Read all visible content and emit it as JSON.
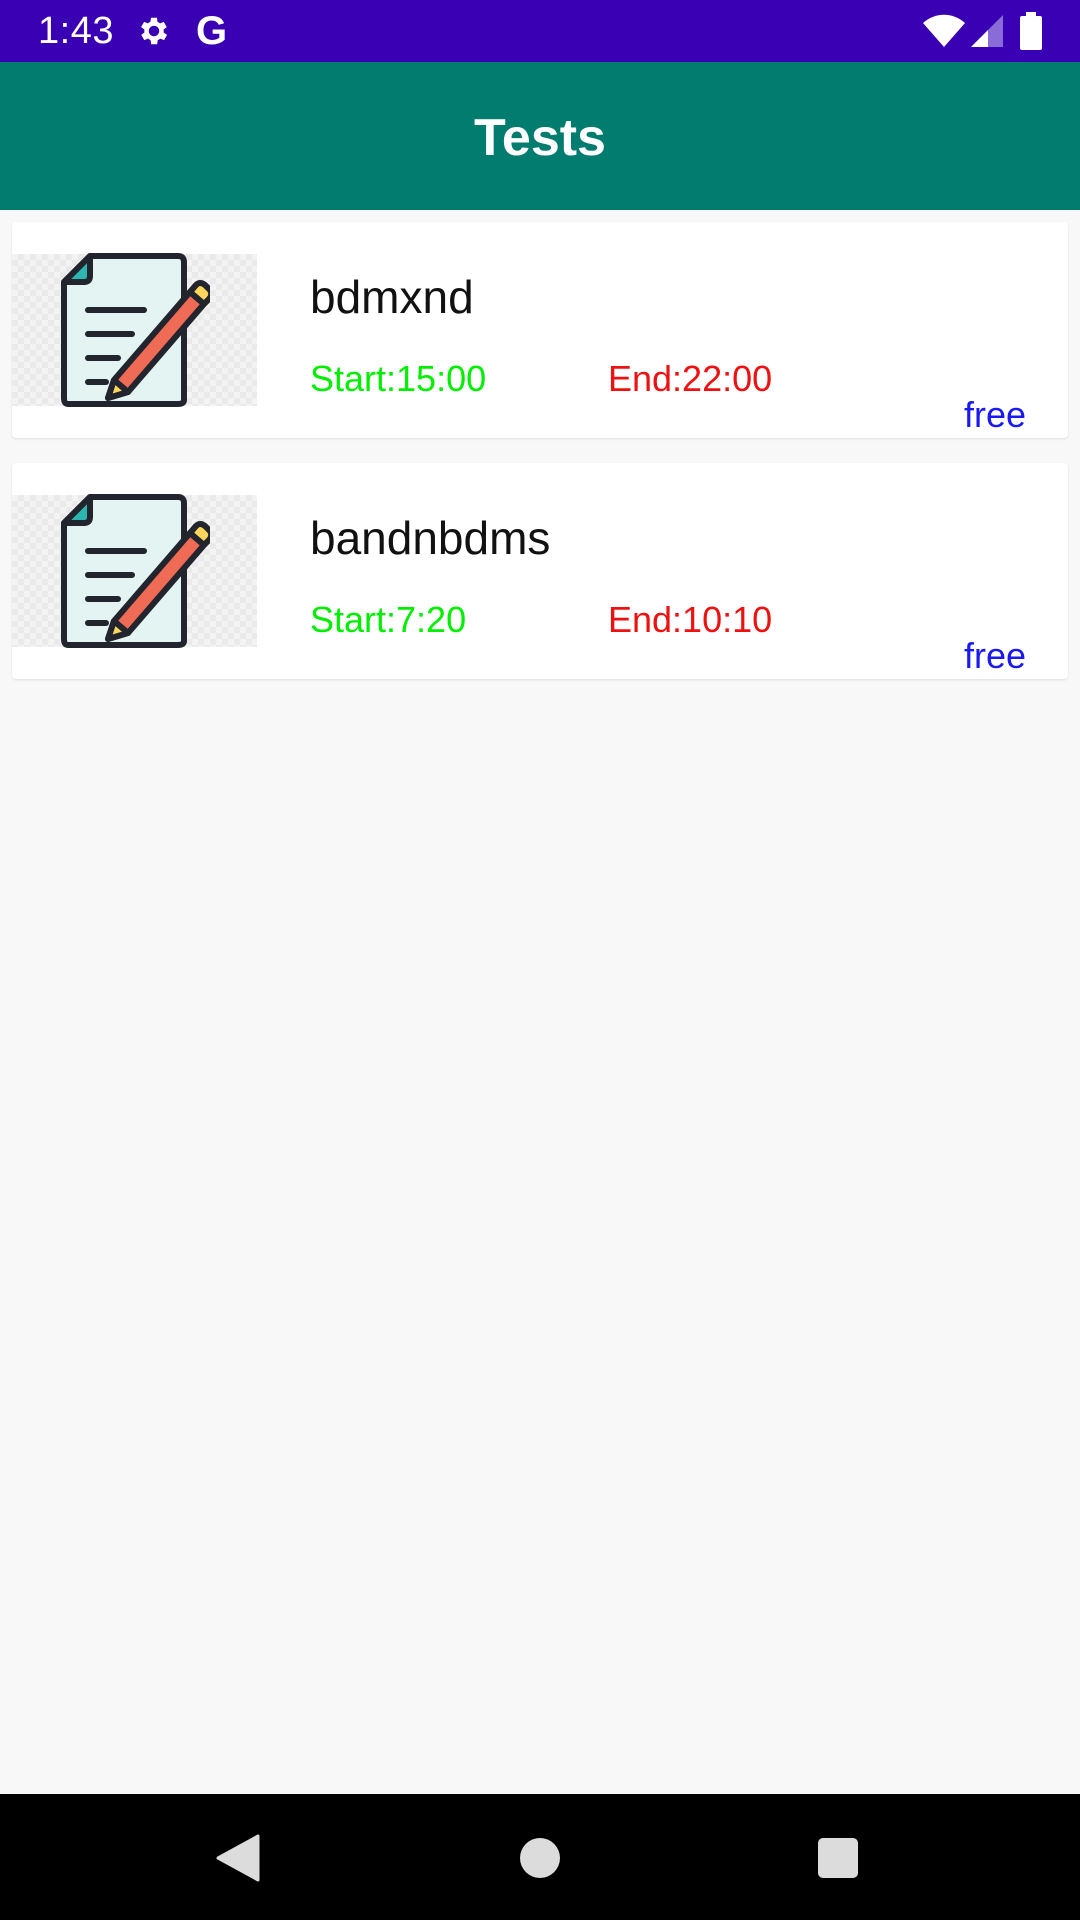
{
  "status_bar": {
    "time": "1:43",
    "google_glyph": "G",
    "icons": [
      "gear-icon",
      "google-icon",
      "wifi-icon",
      "signal-icon",
      "battery-icon"
    ]
  },
  "app_bar": {
    "title": "Tests"
  },
  "tests": [
    {
      "name": "bdmxnd",
      "start": "Start:15:00",
      "end": "End:22:00",
      "badge": "free"
    },
    {
      "name": "bandnbdms",
      "start": "Start:7:20",
      "end": "End:10:10",
      "badge": "free"
    }
  ],
  "colors": {
    "status_bar": "#3a00b3",
    "app_bar": "#037c70",
    "start_text": "#00ee00",
    "end_text": "#ee1111",
    "badge_text": "#1a1aee"
  },
  "nav_bar": {
    "icons": [
      "back-icon",
      "home-icon",
      "recents-icon"
    ]
  }
}
